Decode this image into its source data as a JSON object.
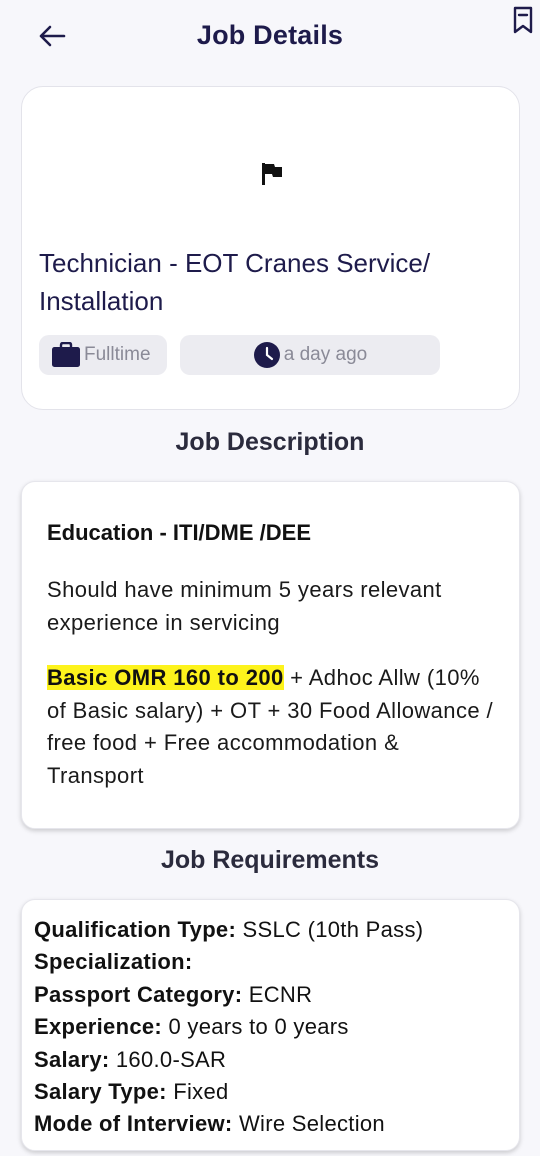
{
  "header": {
    "title": "Job Details",
    "back_icon": "arrow-left-icon",
    "bookmark_icon": "bookmark-icon"
  },
  "job": {
    "company_icon": "flag-icon",
    "title": "Technician - EOT Cranes Service/ Installation",
    "type": "Fulltime",
    "type_icon": "briefcase-icon",
    "posted": "a day ago",
    "posted_icon": "clock-icon"
  },
  "description": {
    "section_title": "Job Description",
    "education": "Education - ITI/DME /DEE",
    "experience_text": "Should have minimum 5 years relevant experience in servicing",
    "salary_highlight": "Basic OMR 160 to 200",
    "salary_rest": " + Adhoc Allw (10% of Basic salary) + OT + 30 Food Allowance / free food + Free accommodation & Transport",
    "highlight_color": "#fdf31c"
  },
  "requirements": {
    "section_title": "Job Requirements",
    "items": [
      {
        "label": "Qualification Type:",
        "value": " SSLC (10th Pass)"
      },
      {
        "label": "Specialization:",
        "value": ""
      },
      {
        "label": "Passport Category:",
        "value": " ECNR"
      },
      {
        "label": "Experience:",
        "value": " 0 years to 0 years"
      },
      {
        "label": "Salary:",
        "value": " 160.0-SAR"
      },
      {
        "label": "Salary Type:",
        "value": " Fixed"
      },
      {
        "label": "Mode of Interview:",
        "value": " Wire Selection"
      }
    ]
  },
  "colors": {
    "primary": "#1e1b4b",
    "background": "#f7f7fb",
    "chip": "#ececf1"
  }
}
